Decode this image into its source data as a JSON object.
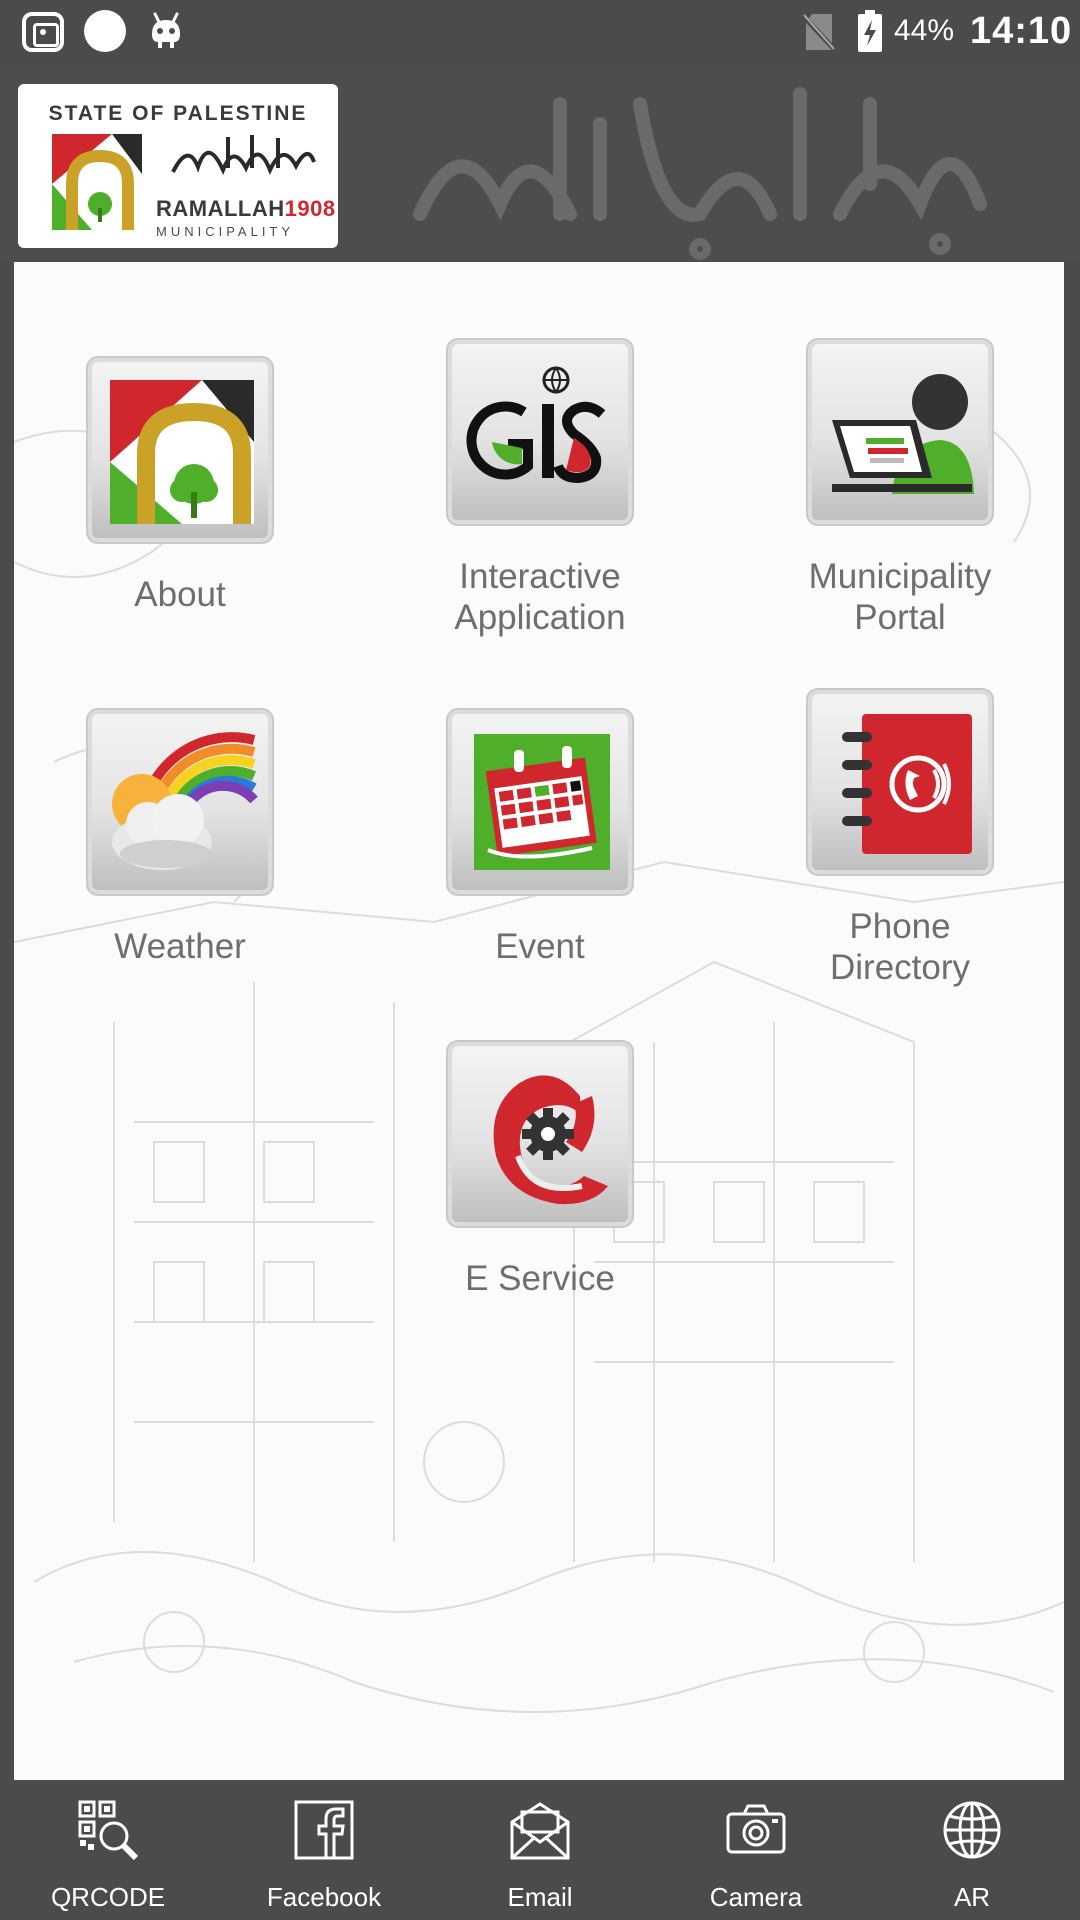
{
  "status_bar": {
    "battery_percent": "44%",
    "time": "14:10",
    "icons": [
      "screenshot-icon",
      "circle-dot-icon",
      "android-icon",
      "no-sim-icon",
      "battery-charging-icon"
    ]
  },
  "header": {
    "logo": {
      "state_text": "STATE OF PALESTINE",
      "city_text": "RAMALLAH",
      "year_text": "1908",
      "municipality_text": "MUNICIPALITY",
      "arabic_text": "بلدية رام الله"
    },
    "calligraphy_text": "بلدية رام الله"
  },
  "menu": {
    "tiles": [
      {
        "label": "About",
        "icon": "palestine-arch-icon"
      },
      {
        "label": "Interactive\nApplication",
        "icon": "gis-icon"
      },
      {
        "label": "Municipality\nPortal",
        "icon": "portal-user-icon"
      },
      {
        "label": "Weather",
        "icon": "weather-rainbow-icon"
      },
      {
        "label": "Event",
        "icon": "calendar-icon"
      },
      {
        "label": "Phone\nDirectory",
        "icon": "phone-book-icon"
      },
      {
        "label": "E Service",
        "icon": "e-service-gear-icon"
      }
    ]
  },
  "bottom_nav": {
    "items": [
      {
        "label": "QRCODE",
        "icon": "qr-search-icon"
      },
      {
        "label": "Facebook",
        "icon": "facebook-icon"
      },
      {
        "label": "Email",
        "icon": "email-icon"
      },
      {
        "label": "Camera",
        "icon": "camera-icon"
      },
      {
        "label": "AR",
        "icon": "globe-icon"
      }
    ]
  },
  "colors": {
    "bar_background": "#4b4b4b",
    "content_background": "#fbfbfb",
    "label_text": "#6e6e6e",
    "brand_red": "#d0272e",
    "brand_green": "#4fae2a"
  }
}
